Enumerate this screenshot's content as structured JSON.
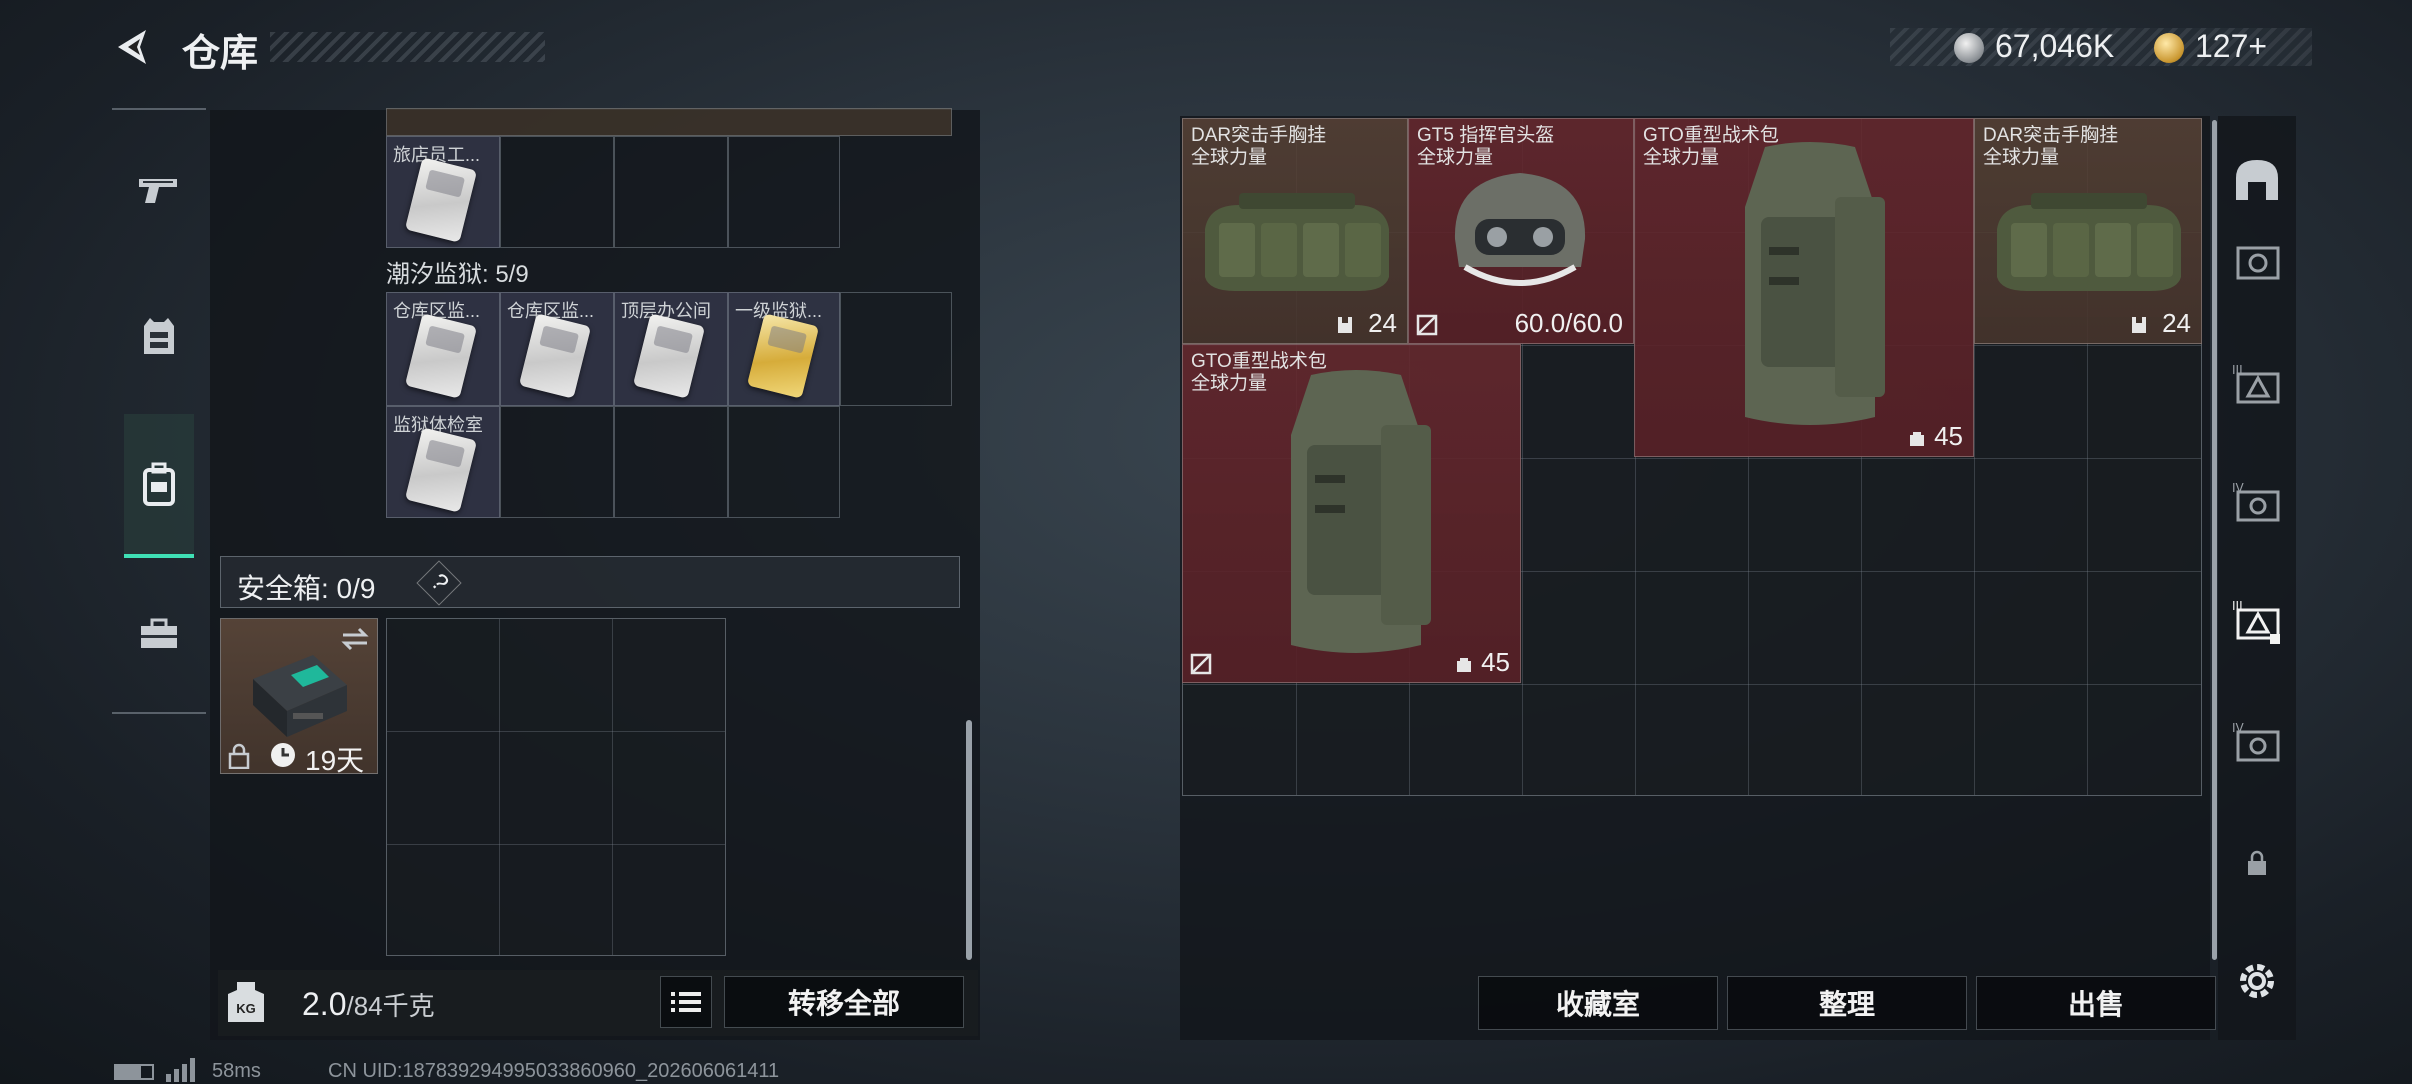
{
  "header": {
    "title": "仓库",
    "currency1_value": "67,046K",
    "currency2_value": "127+"
  },
  "left_tabs": [
    "weapon-icon",
    "armor-icon",
    "backpack-icon",
    "toolbox-icon"
  ],
  "key_section": {
    "row0_label": "旅店员工...",
    "prison_label": "潮汐监狱: 5/9",
    "keys_row1": [
      "仓库区监...",
      "仓库区监...",
      "顶层办公间",
      "一级监狱..."
    ],
    "keys_row2": [
      "监狱体检室"
    ]
  },
  "safebox": {
    "label": "安全箱: 0/9",
    "help": "?",
    "timer": "19天"
  },
  "weight": {
    "value": "2.0",
    "max": "/84千克",
    "kg_badge": "KG"
  },
  "buttons": {
    "transfer_all": "转移全部",
    "collection": "收藏室",
    "organize": "整理",
    "sell": "出售"
  },
  "items": [
    {
      "name": "DAR突击手胸挂",
      "sub": "全球力量",
      "count": "24"
    },
    {
      "name": "GT5 指挥官头盔",
      "sub": "全球力量",
      "count": "60.0/60.0"
    },
    {
      "name": "GTO重型战术包",
      "sub": "全球力量",
      "count": "45"
    },
    {
      "name": "DAR突击手胸挂",
      "sub": "全球力量",
      "count": "24"
    },
    {
      "name": "GTO重型战术包",
      "sub": "全球力量",
      "count": "45"
    }
  ],
  "right_tabs": [
    "home-icon",
    "container-III-icon",
    "container-IV-icon",
    "container-III-selected-icon",
    "container-IV-2-icon",
    "lock-icon",
    "settings-icon"
  ],
  "footer": {
    "ping": "58ms",
    "uid": "CN UID:187839294995033860960_202606061411"
  }
}
